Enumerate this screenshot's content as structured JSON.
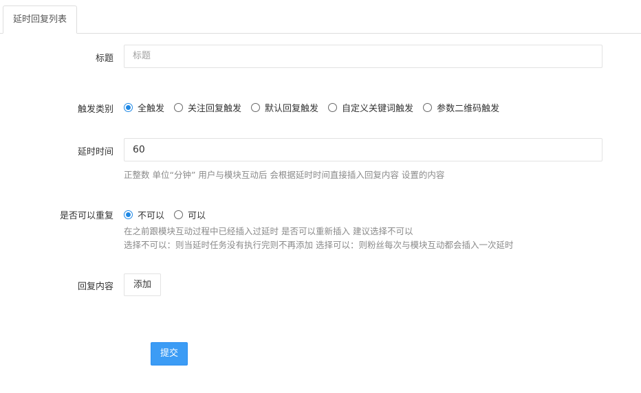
{
  "tabs": {
    "active": "延时回复列表"
  },
  "form": {
    "title": {
      "label": "标题",
      "placeholder": "标题"
    },
    "trigger_type": {
      "label": "触发类别",
      "options": [
        "全触发",
        "关注回复触发",
        "默认回复触发",
        "自定义关键词触发",
        "参数二维码触发"
      ],
      "selected": "全触发"
    },
    "delay_time": {
      "label": "延时时间",
      "value": "60",
      "help": "正整数 单位“分钟” 用户与模块互动后 会根据延时时间直接插入回复内容 设置的内容"
    },
    "repeatable": {
      "label": "是否可以重复",
      "options": [
        "不可以",
        "可以"
      ],
      "selected": "不可以",
      "help_line1": "在之前跟模块互动过程中已经插入过延时 是否可以重新插入 建议选择不可以",
      "help_line2": "选择不可以：则当延时任务没有执行完则不再添加 选择可以：则粉丝每次与模块互动都会插入一次延时"
    },
    "reply_content": {
      "label": "回复内容",
      "add_label": "添加"
    },
    "submit_label": "提交"
  },
  "colors": {
    "accent": "#1e88e5",
    "submit_bg": "#3c9cf5",
    "help_text": "#8a8a8a",
    "border": "#e2e2e2"
  }
}
